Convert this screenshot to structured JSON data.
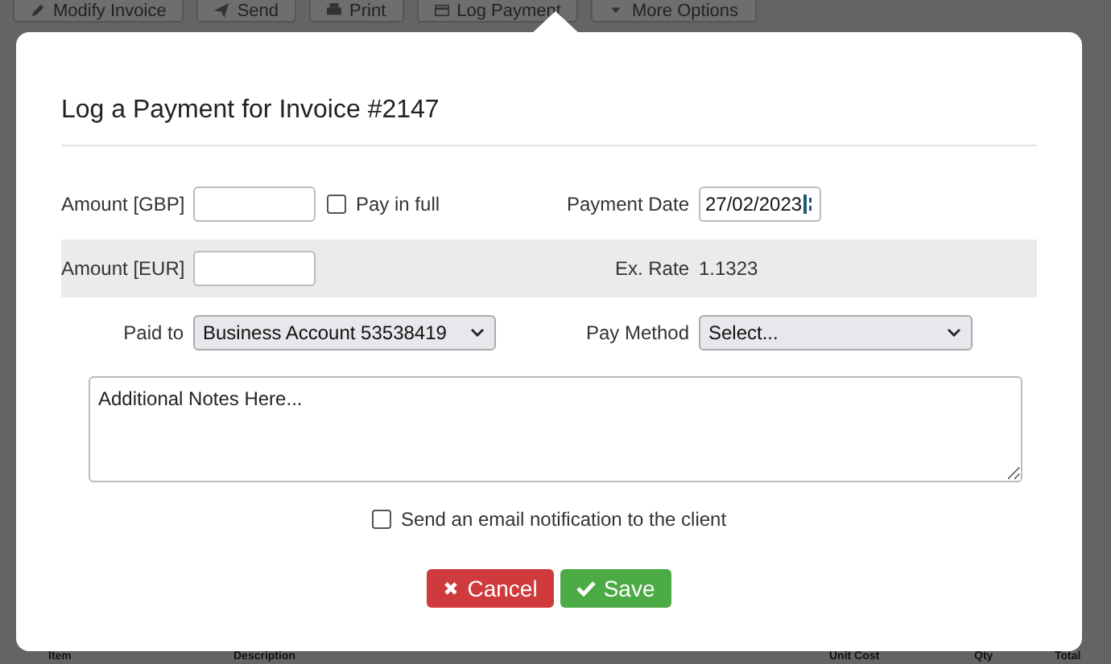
{
  "toolbar": [
    {
      "label": "Modify Invoice"
    },
    {
      "label": "Send"
    },
    {
      "label": "Print"
    },
    {
      "label": "Log Payment"
    },
    {
      "label": "More Options"
    }
  ],
  "dialog": {
    "title": "Log a Payment for Invoice #2147",
    "amount_gbp": {
      "label": "Amount [GBP]"
    },
    "pay_in_full": {
      "label": "Pay in full",
      "checked": false
    },
    "payment_date": {
      "label": "Payment Date",
      "value": "27/02/2023"
    },
    "amount_eur": {
      "label": "Amount [EUR]"
    },
    "ex_rate": {
      "label": "Ex. Rate",
      "value": "1.1323"
    },
    "paid_to": {
      "label": "Paid to",
      "value": "Business Account 53538419"
    },
    "pay_method": {
      "label": "Pay Method",
      "value": "Select..."
    },
    "notes": {
      "placeholder": "Additional Notes Here..."
    },
    "email_notification": {
      "label": "Send an email notification to the client",
      "checked": false
    },
    "buttons": [
      {
        "label": "Cancel",
        "kind": "cancel"
      },
      {
        "label": "Save",
        "kind": "save"
      }
    ]
  },
  "table": {
    "columns": [
      "Item",
      "Description",
      "Unit Cost",
      "Qty",
      "Total"
    ]
  }
}
